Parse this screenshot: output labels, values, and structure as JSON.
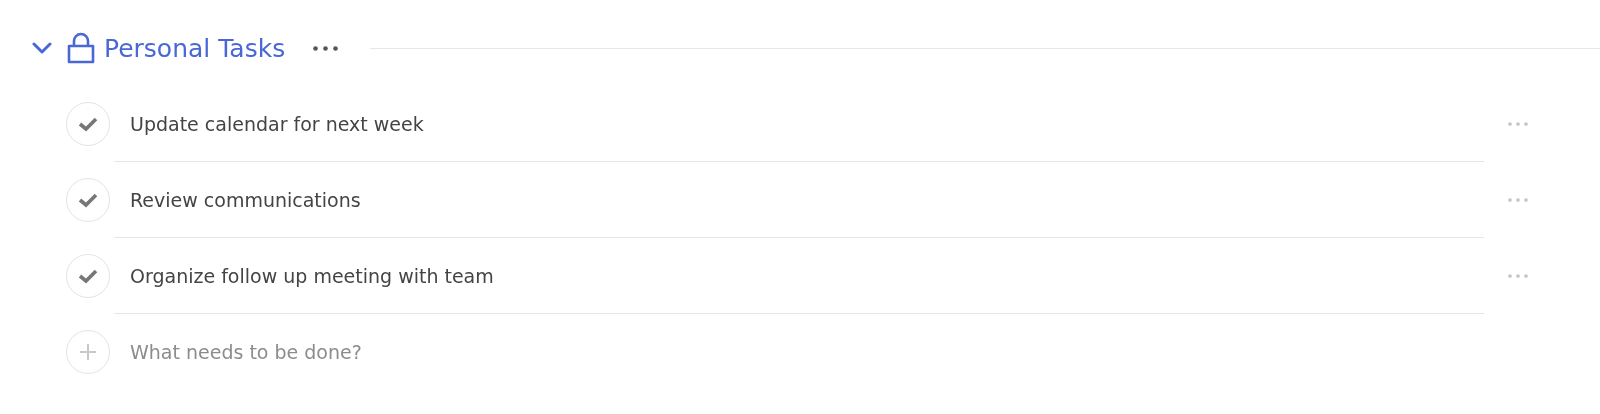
{
  "section": {
    "title": "Personal Tasks",
    "expanded": true
  },
  "tasks": [
    {
      "label": "Update calendar for next week"
    },
    {
      "label": "Review communications"
    },
    {
      "label": "Organize follow up meeting with team"
    }
  ],
  "new_task": {
    "placeholder": "What needs to be done?"
  }
}
